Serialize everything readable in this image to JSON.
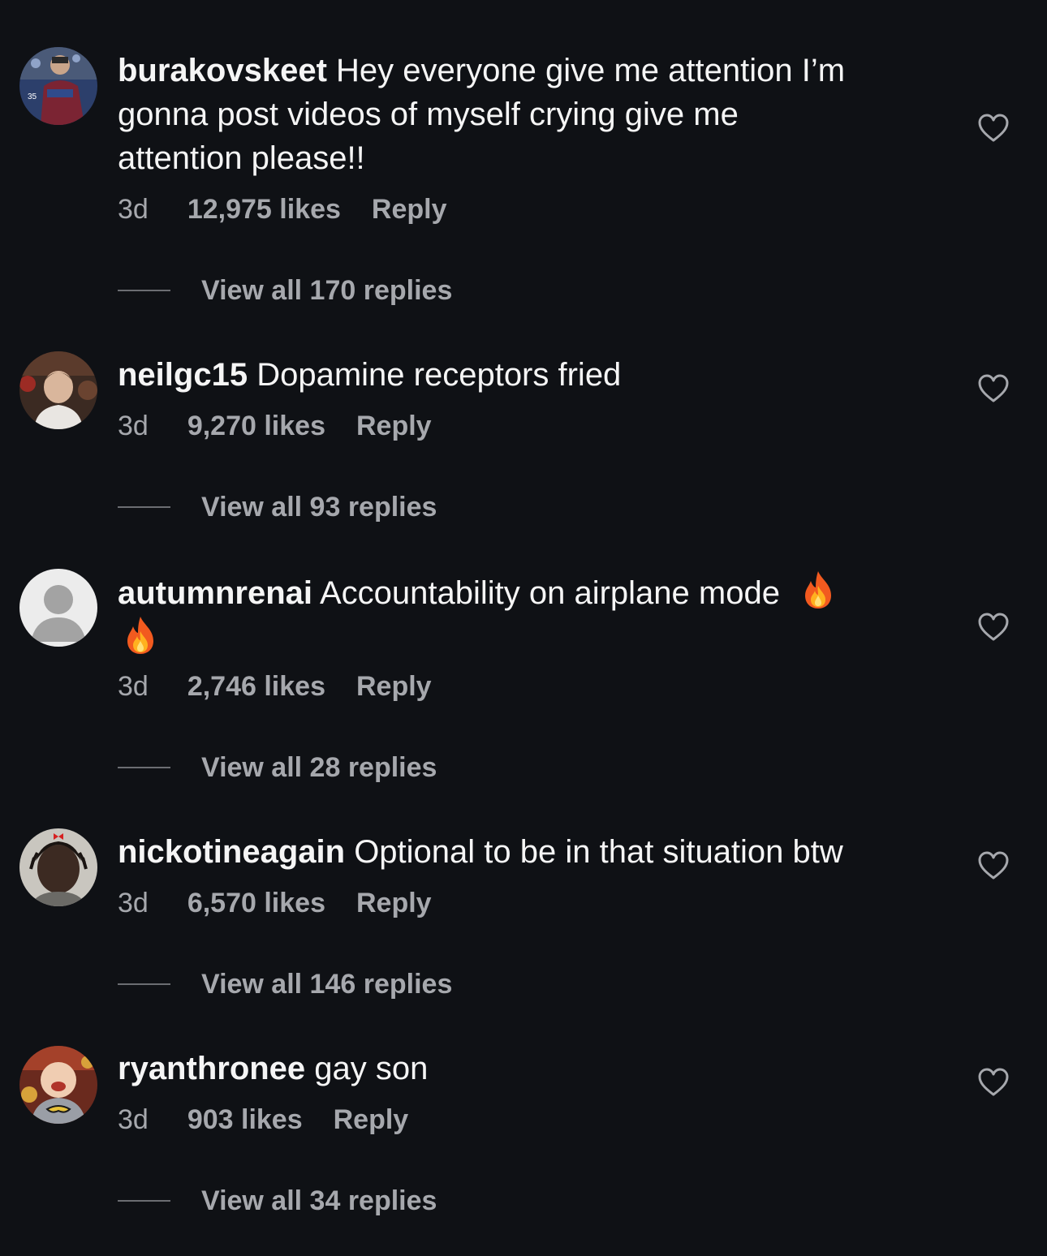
{
  "comments": [
    {
      "username": "burakovskeet",
      "text": "Hey everyone give me attention I’m gonna post videos of myself crying give me attention please!!",
      "text_lines": [
        "Hey everyone give me attention I’m",
        "gonna post videos of myself crying give me",
        "attention please!!"
      ],
      "time": "3d",
      "likes": "12,975 likes",
      "reply": "Reply",
      "view_replies": "View all 170 replies"
    },
    {
      "username": "neilgc15",
      "text": "Dopamine receptors fried",
      "time": "3d",
      "likes": "9,270 likes",
      "reply": "Reply",
      "view_replies": "View all 93 replies"
    },
    {
      "username": "autumnrenai",
      "text": "Accountability on airplane mode",
      "emojis": [
        "fire",
        "fire"
      ],
      "time": "3d",
      "likes": "2,746 likes",
      "reply": "Reply",
      "view_replies": "View all 28 replies"
    },
    {
      "username": "nickotineagain",
      "text": "Optional to be in that situation btw",
      "time": "3d",
      "likes": "6,570 likes",
      "reply": "Reply",
      "view_replies": "View all 146 replies"
    },
    {
      "username": "ryanthronee",
      "text": "gay son",
      "time": "3d",
      "likes": "903 likes",
      "reply": "Reply",
      "view_replies": "View all 34 replies"
    }
  ],
  "icons": {
    "like": "heart-outline-icon",
    "emoji": "fire-emoji"
  },
  "colors": {
    "background": "#0f1115",
    "primary_text": "#f5f5f5",
    "secondary_text": "#a6a8ad"
  }
}
